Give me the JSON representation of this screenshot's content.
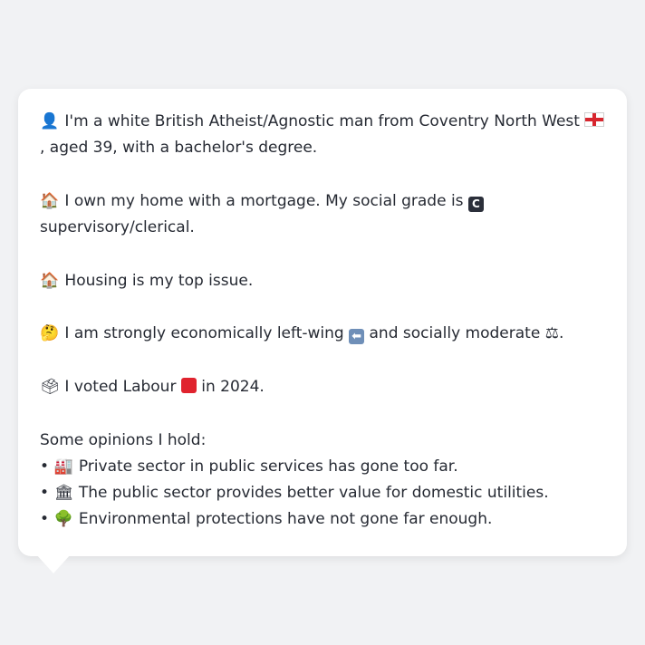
{
  "profile": {
    "line1_a": "I'm a white British Atheist/Agnostic man from Coventry North West",
    "line1_b": ", aged 39, with a bachelor's degree.",
    "home_a": "I own my home with a mortgage. My social grade is",
    "grade_badge": "C",
    "home_b": "supervisory/clerical.",
    "top_issue": "Housing is my top issue.",
    "politics_a": "I am strongly economically left-wing",
    "politics_b": "and socially moderate",
    "politics_c": ".",
    "vote_a": "I voted Labour",
    "vote_b": "in 2024.",
    "opinions_heading": "Some opinions I hold:",
    "bullet_char": "•",
    "opinions": [
      {
        "icon": "factory-icon",
        "text": "Private sector in public services has gone too far."
      },
      {
        "icon": "classical-building-icon",
        "text": "The public sector provides better value for domestic utilities."
      },
      {
        "icon": "tree-icon",
        "text": "Environmental protections have not gone far enough."
      }
    ]
  },
  "icons": {
    "person": "👤",
    "house": "🏠",
    "thinking": "🤔",
    "ballot": "🗳",
    "factory": "🏭",
    "building": "🏛",
    "tree": "🌳",
    "scales": "⚖",
    "arrow": "⬅"
  },
  "colors": {
    "background": "#f1f2f4",
    "card": "#ffffff",
    "text": "#262a33",
    "labour_red": "#e0232e",
    "england_red": "#d7262e"
  }
}
